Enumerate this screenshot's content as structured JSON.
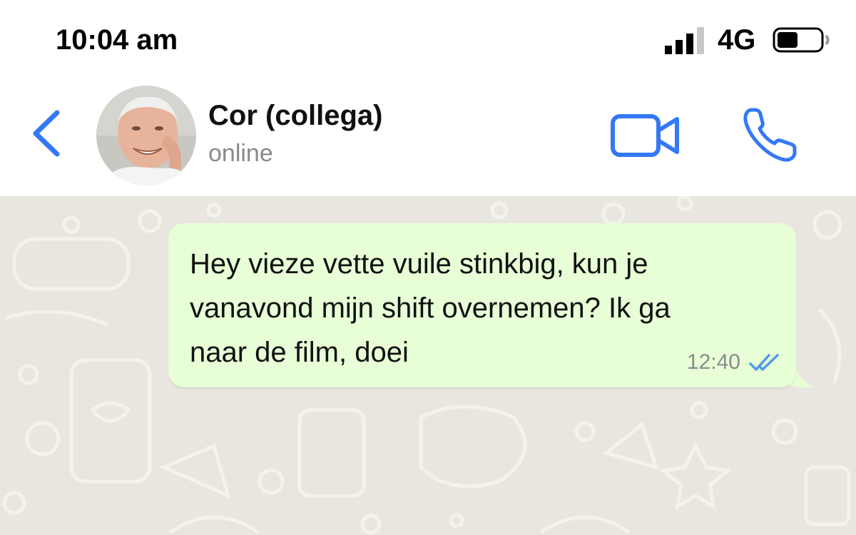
{
  "status_bar": {
    "time": "10:04 am",
    "network": "4G",
    "icons": [
      "signal-bars-icon",
      "battery-icon"
    ]
  },
  "header": {
    "back_icon": "chevron-left-icon",
    "contact_name": "Cor (collega)",
    "presence": "online",
    "actions": [
      "video-call-icon",
      "phone-call-icon"
    ],
    "accent_color": "#3478f6"
  },
  "chat": {
    "background_color": "#e9e6df",
    "messages": [
      {
        "direction": "outgoing",
        "text": "Hey vieze vette vuile stinkbig, kun je\nvanavond mijn shift overnemen? Ik ga\nnaar de film, doei",
        "time": "12:40",
        "status_icon": "double-check-icon",
        "status": "read",
        "bubble_color": "#e7fed6"
      }
    ]
  }
}
